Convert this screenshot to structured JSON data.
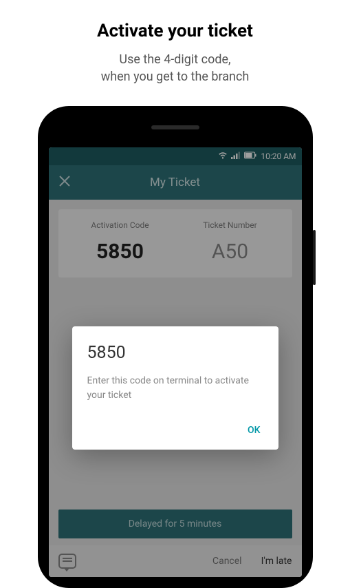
{
  "header": {
    "title": "Activate your ticket",
    "subtitle_line1": "Use the 4-digit code,",
    "subtitle_line2": "when you get to the branch"
  },
  "status_bar": {
    "time": "10:20 AM"
  },
  "app_header": {
    "title": "My Ticket"
  },
  "ticket_card": {
    "activation_label": "Activation Code",
    "activation_value": "5850",
    "ticket_label": "Ticket Number",
    "ticket_value": "A50"
  },
  "dialog": {
    "code": "5850",
    "message": "Enter this code on terminal to activate your ticket",
    "ok_label": "OK"
  },
  "delayed_banner": "Delayed for 5 minutes",
  "bottom_actions": {
    "cancel": "Cancel",
    "late": "I'm late"
  }
}
